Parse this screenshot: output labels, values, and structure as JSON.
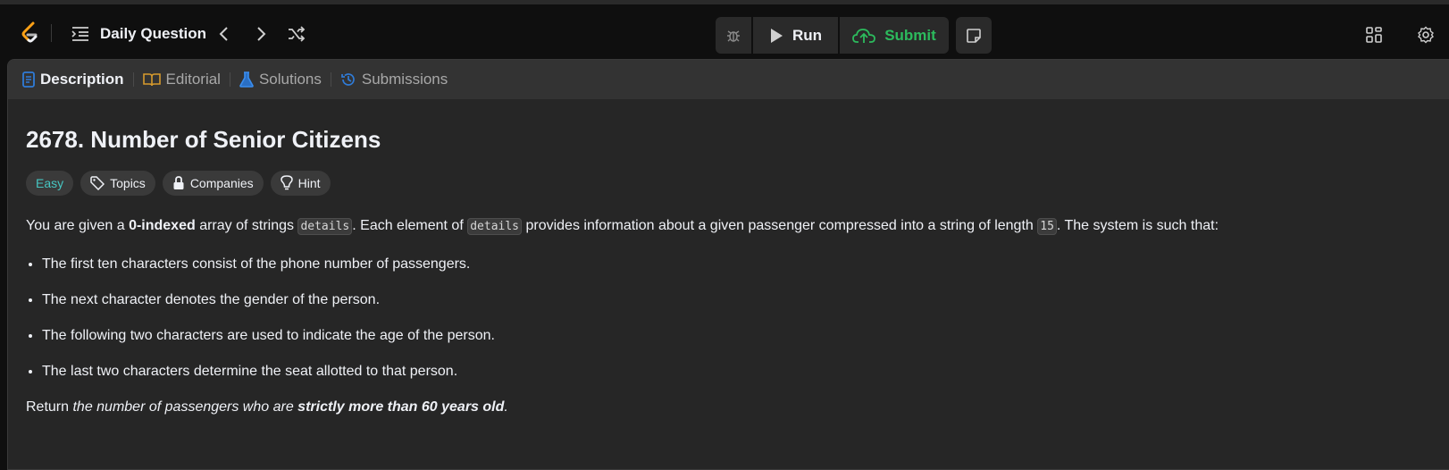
{
  "header": {
    "title": "Daily Question",
    "run_label": "Run",
    "submit_label": "Submit",
    "colors": {
      "submit": "#2cbb5d",
      "logo_orange": "#ffa116"
    }
  },
  "tabs": [
    {
      "label": "Description",
      "icon": "description-icon"
    },
    {
      "label": "Editorial",
      "icon": "book-icon"
    },
    {
      "label": "Solutions",
      "icon": "flask-icon"
    },
    {
      "label": "Submissions",
      "icon": "history-icon"
    }
  ],
  "problem": {
    "title": "2678. Number of Senior Citizens",
    "difficulty": "Easy",
    "chips": [
      "Topics",
      "Companies",
      "Hint"
    ],
    "desc": {
      "p1": "You are given a ",
      "b1": "0-indexed",
      "p2": " array of strings ",
      "c1": "details",
      "p3": ". Each element of ",
      "c2": "details",
      "p4": " provides information about a given passenger compressed into a string of length ",
      "c3": "15",
      "p5": ". The system is such that:"
    },
    "bullets": [
      "The first ten characters consist of the phone number of passengers.",
      "The next character denotes the gender of the person.",
      "The following two characters are used to indicate the age of the person.",
      "The last two characters determine the seat allotted to that person."
    ],
    "return": {
      "prefix": "Return ",
      "italic": "the number of passengers who are ",
      "bold_italic": "strictly more than 60 years old",
      "suffix": "."
    }
  }
}
